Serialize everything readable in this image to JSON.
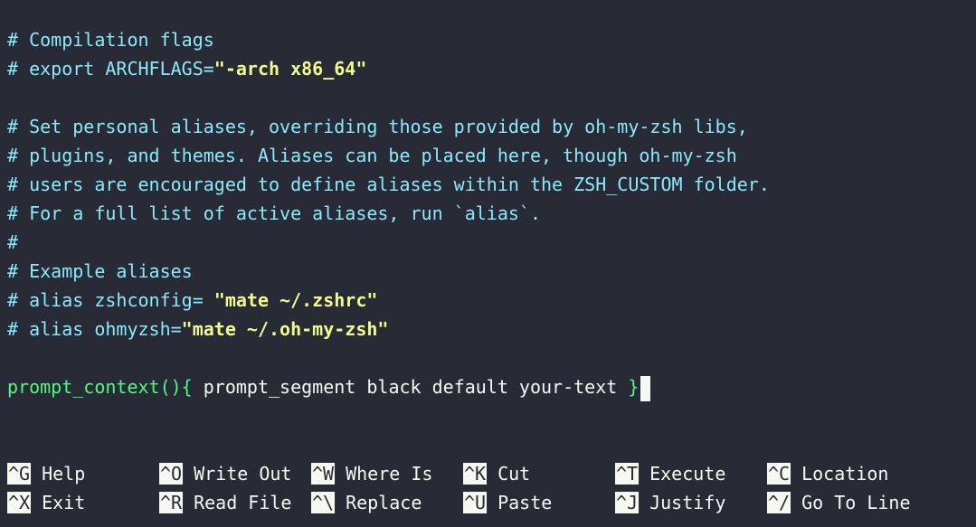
{
  "editor": {
    "lines": [
      "",
      "# Compilation flags",
      "# export ARCHFLAGS=",
      "\"-arch x86_64\"",
      "# Set personal aliases, overriding those provided by oh-my-zsh libs,",
      "# plugins, and themes. Aliases can be placed here, though oh-my-zsh",
      "# users are encouraged to define aliases within the ZSH_CUSTOM folder.",
      "# For a full list of active aliases, run `alias`.",
      "#",
      "# Example aliases",
      "# alias zshconfig= ",
      "\"mate ~/.zshrc\"",
      "# alias ohmyzsh=",
      "\"mate ~/.oh-my-zsh\"",
      "prompt_context(){",
      " prompt_segment black default your-text ",
      "}"
    ]
  },
  "shortcuts": {
    "row1": [
      {
        "key": "^G",
        "label": "Help"
      },
      {
        "key": "^O",
        "label": "Write Out"
      },
      {
        "key": "^W",
        "label": "Where Is"
      },
      {
        "key": "^K",
        "label": "Cut"
      },
      {
        "key": "^T",
        "label": "Execute"
      },
      {
        "key": "^C",
        "label": "Location"
      }
    ],
    "row2": [
      {
        "key": "^X",
        "label": "Exit"
      },
      {
        "key": "^R",
        "label": "Read File"
      },
      {
        "key": "^\\",
        "label": "Replace"
      },
      {
        "key": "^U",
        "label": "Paste"
      },
      {
        "key": "^J",
        "label": "Justify"
      },
      {
        "key": "^/",
        "label": "Go To Line"
      }
    ]
  },
  "colors": {
    "background": "#282a36",
    "comment": "#8be9fd",
    "string": "#f1fa8c",
    "function": "#50fa7b",
    "text": "#f8f8f2"
  }
}
